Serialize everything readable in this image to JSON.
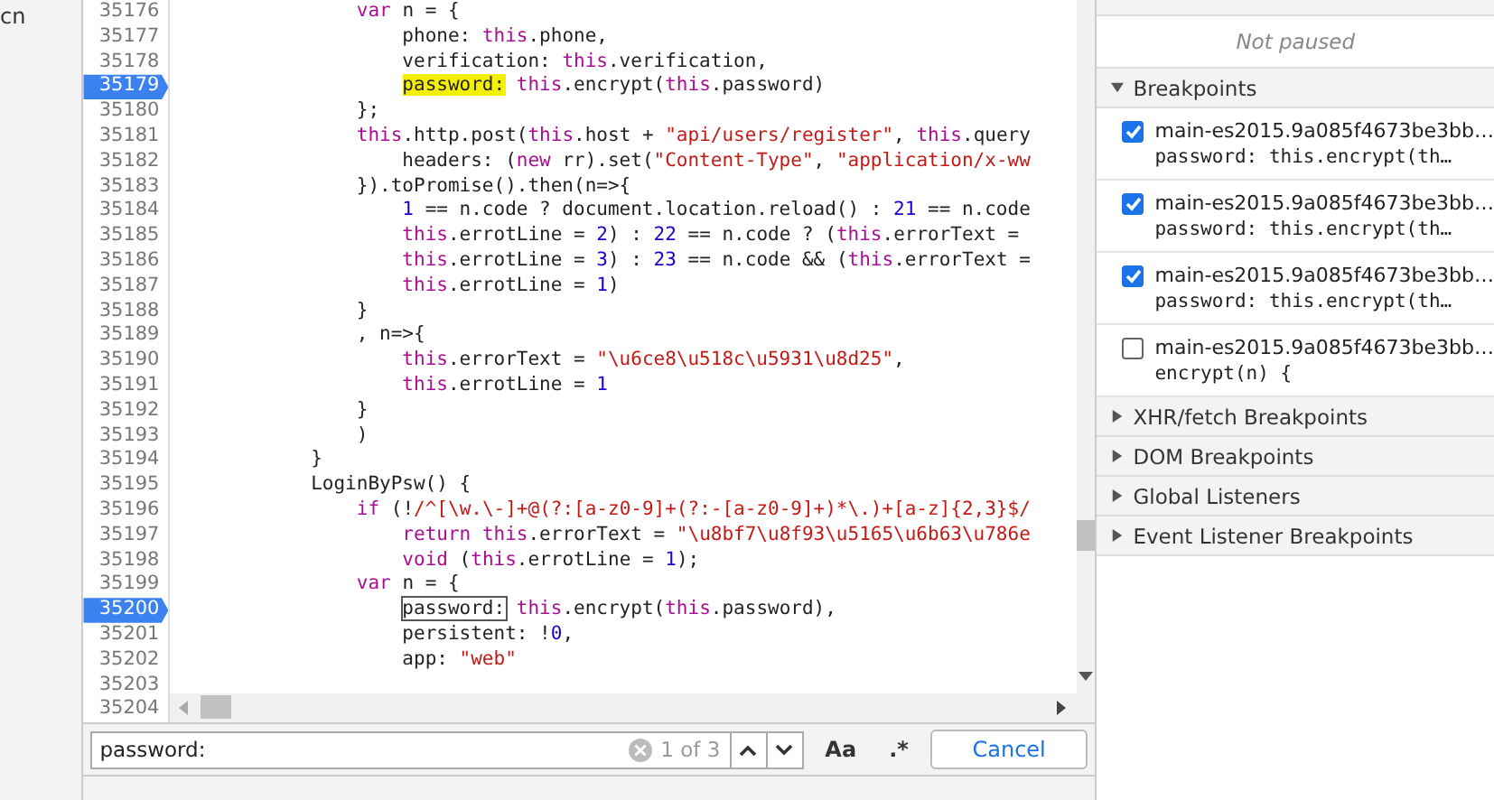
{
  "navigator": {
    "item": "cn"
  },
  "editor": {
    "lines": [
      {
        "number": "35176",
        "breakpoint": false,
        "segments": [
          {
            "kind": "kw",
            "text": "                var"
          },
          {
            "kind": "plain",
            "text": " n = {"
          }
        ]
      },
      {
        "number": "35177",
        "breakpoint": false,
        "segments": [
          {
            "kind": "plain",
            "text": "                    phone: "
          },
          {
            "kind": "kw",
            "text": "this"
          },
          {
            "kind": "plain",
            "text": ".phone,"
          }
        ]
      },
      {
        "number": "35178",
        "breakpoint": false,
        "segments": [
          {
            "kind": "plain",
            "text": "                    verification: "
          },
          {
            "kind": "kw",
            "text": "this"
          },
          {
            "kind": "plain",
            "text": ".verification,"
          }
        ]
      },
      {
        "number": "35179",
        "breakpoint": true,
        "segments": [
          {
            "kind": "match",
            "text": "                    password:"
          },
          {
            "kind": "kw",
            "text": " this"
          },
          {
            "kind": "plain",
            "text": ".encrypt("
          },
          {
            "kind": "kw",
            "text": "this"
          },
          {
            "kind": "plain",
            "text": ".password)"
          }
        ]
      },
      {
        "number": "35180",
        "breakpoint": false,
        "segments": [
          {
            "kind": "plain",
            "text": "                };"
          }
        ]
      },
      {
        "number": "35181",
        "breakpoint": false,
        "segments": [
          {
            "kind": "kw",
            "text": "                this"
          },
          {
            "kind": "plain",
            "text": ".http.post("
          },
          {
            "kind": "kw",
            "text": "this"
          },
          {
            "kind": "plain",
            "text": ".host + "
          },
          {
            "kind": "str",
            "text": "\"api/users/register\""
          },
          {
            "kind": "plain",
            "text": ", "
          },
          {
            "kind": "kw",
            "text": "this"
          },
          {
            "kind": "plain",
            "text": ".query"
          }
        ]
      },
      {
        "number": "35182",
        "breakpoint": false,
        "segments": [
          {
            "kind": "plain",
            "text": "                    headers: ("
          },
          {
            "kind": "kw",
            "text": "new"
          },
          {
            "kind": "plain",
            "text": " rr).set("
          },
          {
            "kind": "str",
            "text": "\"Content-Type\""
          },
          {
            "kind": "plain",
            "text": ", "
          },
          {
            "kind": "str",
            "text": "\"application/x-ww"
          }
        ]
      },
      {
        "number": "35183",
        "breakpoint": false,
        "segments": [
          {
            "kind": "plain",
            "text": "                }).toPromise().then(n=>{"
          }
        ]
      },
      {
        "number": "35184",
        "breakpoint": false,
        "segments": [
          {
            "kind": "num",
            "text": "                    1"
          },
          {
            "kind": "plain",
            "text": " == n.code ? document.location.reload() : "
          },
          {
            "kind": "num",
            "text": "21"
          },
          {
            "kind": "plain",
            "text": " == n.code"
          }
        ]
      },
      {
        "number": "35185",
        "breakpoint": false,
        "segments": [
          {
            "kind": "kw",
            "text": "                    this"
          },
          {
            "kind": "plain",
            "text": ".errotLine = "
          },
          {
            "kind": "num",
            "text": "2"
          },
          {
            "kind": "plain",
            "text": ") : "
          },
          {
            "kind": "num",
            "text": "22"
          },
          {
            "kind": "plain",
            "text": " == n.code ? ("
          },
          {
            "kind": "kw",
            "text": "this"
          },
          {
            "kind": "plain",
            "text": ".errorText ="
          }
        ]
      },
      {
        "number": "35186",
        "breakpoint": false,
        "segments": [
          {
            "kind": "kw",
            "text": "                    this"
          },
          {
            "kind": "plain",
            "text": ".errotLine = "
          },
          {
            "kind": "num",
            "text": "3"
          },
          {
            "kind": "plain",
            "text": ") : "
          },
          {
            "kind": "num",
            "text": "23"
          },
          {
            "kind": "plain",
            "text": " == n.code && ("
          },
          {
            "kind": "kw",
            "text": "this"
          },
          {
            "kind": "plain",
            "text": ".errorText ="
          }
        ]
      },
      {
        "number": "35187",
        "breakpoint": false,
        "segments": [
          {
            "kind": "kw",
            "text": "                    this"
          },
          {
            "kind": "plain",
            "text": ".errotLine = "
          },
          {
            "kind": "num",
            "text": "1"
          },
          {
            "kind": "plain",
            "text": ")"
          }
        ]
      },
      {
        "number": "35188",
        "breakpoint": false,
        "segments": [
          {
            "kind": "plain",
            "text": "                }"
          }
        ]
      },
      {
        "number": "35189",
        "breakpoint": false,
        "segments": [
          {
            "kind": "plain",
            "text": "                , n=>{"
          }
        ]
      },
      {
        "number": "35190",
        "breakpoint": false,
        "segments": [
          {
            "kind": "kw",
            "text": "                    this"
          },
          {
            "kind": "plain",
            "text": ".errorText = "
          },
          {
            "kind": "str",
            "text": "\"\\u6ce8\\u518c\\u5931\\u8d25\""
          },
          {
            "kind": "plain",
            "text": ","
          }
        ]
      },
      {
        "number": "35191",
        "breakpoint": false,
        "segments": [
          {
            "kind": "kw",
            "text": "                    this"
          },
          {
            "kind": "plain",
            "text": ".errotLine = "
          },
          {
            "kind": "num",
            "text": "1"
          }
        ]
      },
      {
        "number": "35192",
        "breakpoint": false,
        "segments": [
          {
            "kind": "plain",
            "text": "                }"
          }
        ]
      },
      {
        "number": "35193",
        "breakpoint": false,
        "segments": [
          {
            "kind": "plain",
            "text": "                )"
          }
        ]
      },
      {
        "number": "35194",
        "breakpoint": false,
        "segments": [
          {
            "kind": "plain",
            "text": "            }"
          }
        ]
      },
      {
        "number": "35195",
        "breakpoint": false,
        "segments": [
          {
            "kind": "plain",
            "text": "            LoginByPsw() {"
          }
        ]
      },
      {
        "number": "35196",
        "breakpoint": false,
        "segments": [
          {
            "kind": "kw",
            "text": "                if"
          },
          {
            "kind": "plain",
            "text": " (!"
          },
          {
            "kind": "str",
            "text": "/^[\\w.\\-]+@(?:[a-z0-9]+(?:-[a-z0-9]+)*\\.)+[a-z]{2,3}$/"
          }
        ]
      },
      {
        "number": "35197",
        "breakpoint": false,
        "segments": [
          {
            "kind": "kw",
            "text": "                    return"
          },
          {
            "kind": "kw",
            "text": " this"
          },
          {
            "kind": "plain",
            "text": ".errorText = "
          },
          {
            "kind": "str",
            "text": "\"\\u8bf7\\u8f93\\u5165\\u6b63\\u786e"
          }
        ]
      },
      {
        "number": "35198",
        "breakpoint": false,
        "segments": [
          {
            "kind": "kw",
            "text": "                    void"
          },
          {
            "kind": "plain",
            "text": " ("
          },
          {
            "kind": "kw",
            "text": "this"
          },
          {
            "kind": "plain",
            "text": ".errotLine = "
          },
          {
            "kind": "num",
            "text": "1"
          },
          {
            "kind": "plain",
            "text": ");"
          }
        ]
      },
      {
        "number": "35199",
        "breakpoint": false,
        "segments": [
          {
            "kind": "kw",
            "text": "                var"
          },
          {
            "kind": "plain",
            "text": " n = {"
          }
        ]
      },
      {
        "number": "35200",
        "breakpoint": true,
        "segments": [
          {
            "kind": "current",
            "text": "                    password:"
          },
          {
            "kind": "kw",
            "text": " this"
          },
          {
            "kind": "plain",
            "text": ".encrypt("
          },
          {
            "kind": "kw",
            "text": "this"
          },
          {
            "kind": "plain",
            "text": ".password),"
          }
        ]
      },
      {
        "number": "35201",
        "breakpoint": false,
        "segments": [
          {
            "kind": "plain",
            "text": "                    persistent: !"
          },
          {
            "kind": "num",
            "text": "0"
          },
          {
            "kind": "plain",
            "text": ","
          }
        ]
      },
      {
        "number": "35202",
        "breakpoint": false,
        "segments": [
          {
            "kind": "plain",
            "text": "                    app: "
          },
          {
            "kind": "str",
            "text": "\"web\""
          }
        ]
      },
      {
        "number": "35203",
        "breakpoint": false
      },
      {
        "number": "35204",
        "breakpoint": false
      }
    ]
  },
  "search": {
    "value": "password:",
    "match_count": "1 of 3",
    "case_toggle": "Aa",
    "regex_toggle": ".*",
    "cancel": "Cancel"
  },
  "sidebar": {
    "scope_message": "Not paused",
    "sections": [
      {
        "title": "Breakpoints",
        "expanded": true,
        "items": [
          {
            "file": "main-es2015.9a085f4673be3bb…",
            "code": "password: this.encrypt(th…",
            "checked": true
          },
          {
            "file": "main-es2015.9a085f4673be3bb…",
            "code": "password: this.encrypt(th…",
            "checked": true
          },
          {
            "file": "main-es2015.9a085f4673be3bb…",
            "code": "password: this.encrypt(th…",
            "checked": true
          },
          {
            "file": "main-es2015.9a085f4673be3bb…",
            "code": "encrypt(n) {",
            "checked": false
          }
        ]
      },
      {
        "title": "XHR/fetch Breakpoints",
        "expanded": false
      },
      {
        "title": "DOM Breakpoints",
        "expanded": false
      },
      {
        "title": "Global Listeners",
        "expanded": false
      },
      {
        "title": "Event Listener Breakpoints",
        "expanded": false
      }
    ]
  }
}
